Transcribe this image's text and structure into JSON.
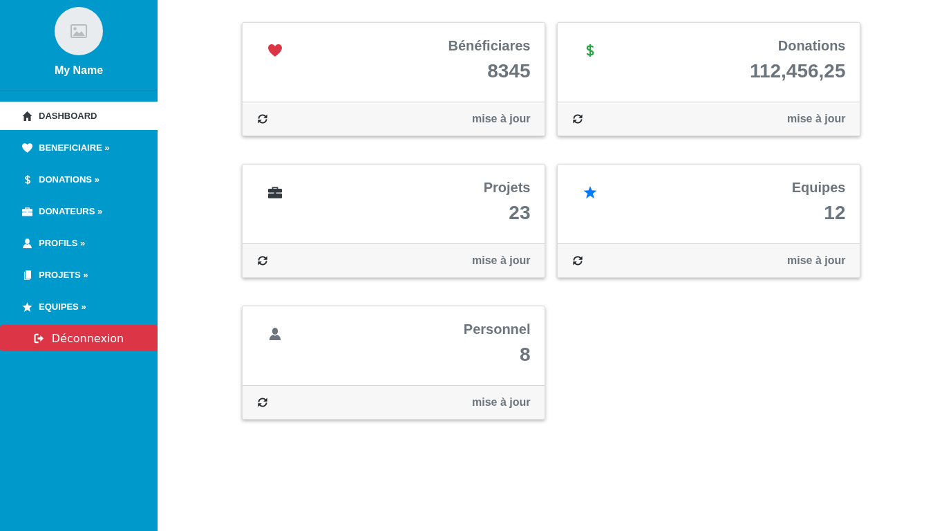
{
  "sidebar": {
    "profile": {
      "name": "My Name"
    },
    "nav": [
      {
        "label": "DASHBOARD",
        "kind": "home",
        "selected": true
      },
      {
        "label": "BENEFICIAIRE »",
        "kind": "heart",
        "selected": false
      },
      {
        "label": "DONATIONS »",
        "kind": "dollar",
        "selected": false
      },
      {
        "label": "DONATEURS »",
        "kind": "briefcase",
        "selected": false
      },
      {
        "label": "PROFILS »",
        "kind": "user",
        "selected": false
      },
      {
        "label": "PROJETS »",
        "kind": "book",
        "selected": false
      },
      {
        "label": "EQUIPES »",
        "kind": "star",
        "selected": false
      }
    ],
    "logout": {
      "label": "Déconnexion"
    }
  },
  "cards": [
    {
      "title": "Bénéficiares",
      "value": "8345",
      "kind": "heart",
      "color": "#dc3545",
      "footer": "mise à jour"
    },
    {
      "title": "Donations",
      "value": "112,456,25",
      "kind": "dollar",
      "color": "#28a745",
      "footer": "mise à jour"
    },
    {
      "title": "Projets",
      "value": "23",
      "kind": "briefcase",
      "color": "#343a40",
      "footer": "mise à jour"
    },
    {
      "title": "Equipes",
      "value": "12",
      "kind": "star",
      "color": "#007bff",
      "footer": "mise à jour"
    },
    {
      "title": "Personnel",
      "value": "8",
      "kind": "user",
      "color": "#6c757d",
      "footer": "mise à jour"
    }
  ]
}
